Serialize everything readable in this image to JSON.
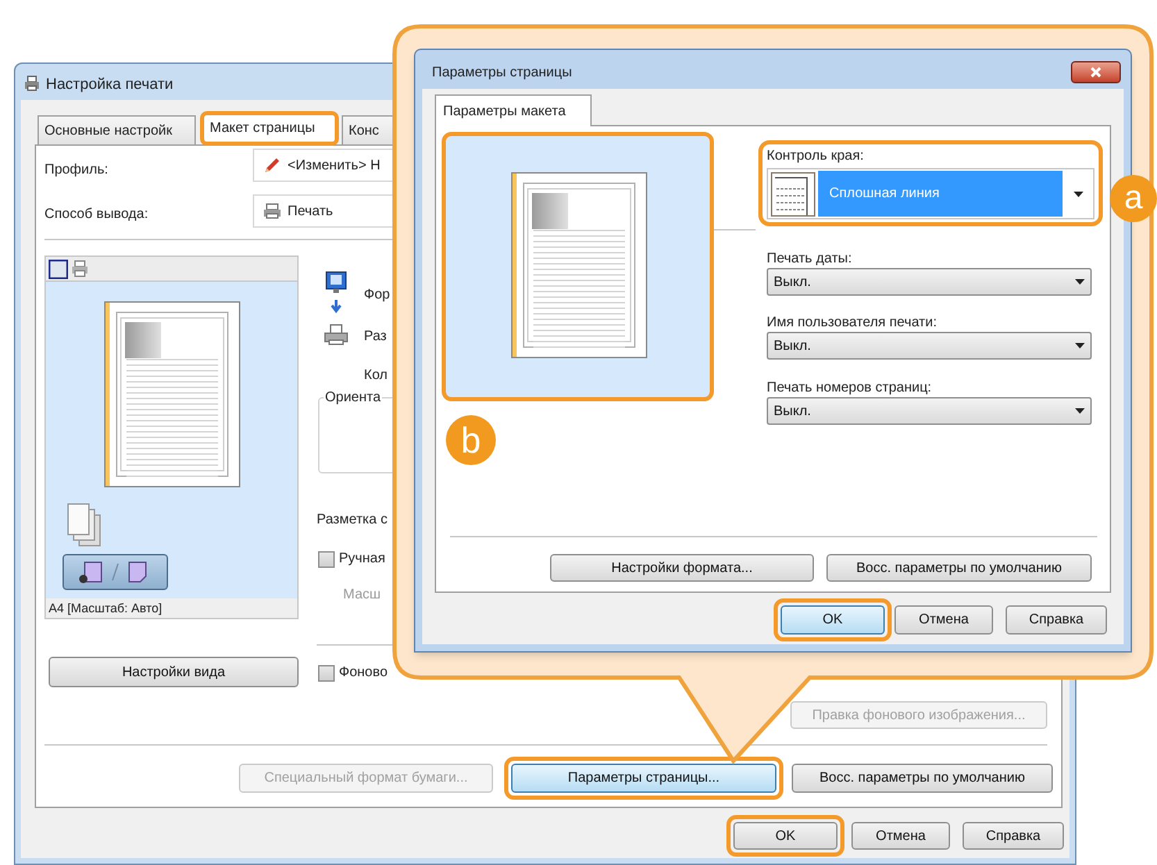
{
  "main_window": {
    "title": "Настройка печати",
    "tabs": [
      {
        "label": "Основные настройк",
        "selected": false,
        "highlighted": false
      },
      {
        "label": "Макет страницы",
        "selected": true,
        "highlighted": true
      },
      {
        "label": "Конс",
        "selected": false,
        "highlighted": false
      }
    ],
    "profile": {
      "label": "Профиль:",
      "value": "<Изменить> Н"
    },
    "output_method": {
      "label": "Способ вывода:",
      "value": "Печать"
    },
    "preview": {
      "caption": "A4 [Масштаб: Авто]"
    },
    "view_settings_button": "Настройки вида",
    "flow_labels": [
      "Фор",
      "Раз",
      "Кол"
    ],
    "orientation_group": "Ориента",
    "layout_label": "Разметка с",
    "checkboxes": [
      {
        "label": "Ручная",
        "checked": false
      },
      {
        "label": "Фоново",
        "checked": false
      }
    ],
    "scale_label": "Масш",
    "buttons": [
      {
        "label": "Правка фонового изображения...",
        "disabled": true,
        "focused": false,
        "highlighted": false
      },
      {
        "label": "Специальный формат бумаги...",
        "disabled": true,
        "focused": false,
        "highlighted": false
      },
      {
        "label": "Параметры страницы...",
        "disabled": false,
        "focused": true,
        "highlighted": true
      },
      {
        "label": "Восс. параметры по умолчанию",
        "disabled": false,
        "focused": false,
        "highlighted": false
      }
    ],
    "footer_buttons": [
      {
        "label": "OK",
        "focused": false,
        "highlighted": true
      },
      {
        "label": "Отмена",
        "focused": false,
        "highlighted": false
      },
      {
        "label": "Справка",
        "focused": false,
        "highlighted": false
      }
    ]
  },
  "page_dialog": {
    "title": "Параметры страницы",
    "tabs": [
      {
        "label": "Параметры макета",
        "selected": true
      }
    ],
    "preview": {
      "highlighted": true
    },
    "edge_control": {
      "label": "Контроль края:",
      "value": "Сплошная линия",
      "highlighted": true
    },
    "selects": [
      {
        "label": "Печать даты:",
        "value": "Выкл."
      },
      {
        "label": "Имя пользователя печати:",
        "value": "Выкл."
      },
      {
        "label": "Печать номеров страниц:",
        "value": "Выкл."
      }
    ],
    "buttons": [
      {
        "label": "Настройки формата...",
        "focused": false,
        "highlighted": false
      },
      {
        "label": "Восс. параметры по умолчанию",
        "focused": false,
        "highlighted": false
      }
    ],
    "footer_buttons": [
      {
        "label": "OK",
        "focused": true,
        "highlighted": true
      },
      {
        "label": "Отмена",
        "focused": false,
        "highlighted": false
      },
      {
        "label": "Справка",
        "focused": false,
        "highlighted": false
      }
    ]
  },
  "callouts": [
    {
      "label": "a"
    },
    {
      "label": "b"
    }
  ]
}
